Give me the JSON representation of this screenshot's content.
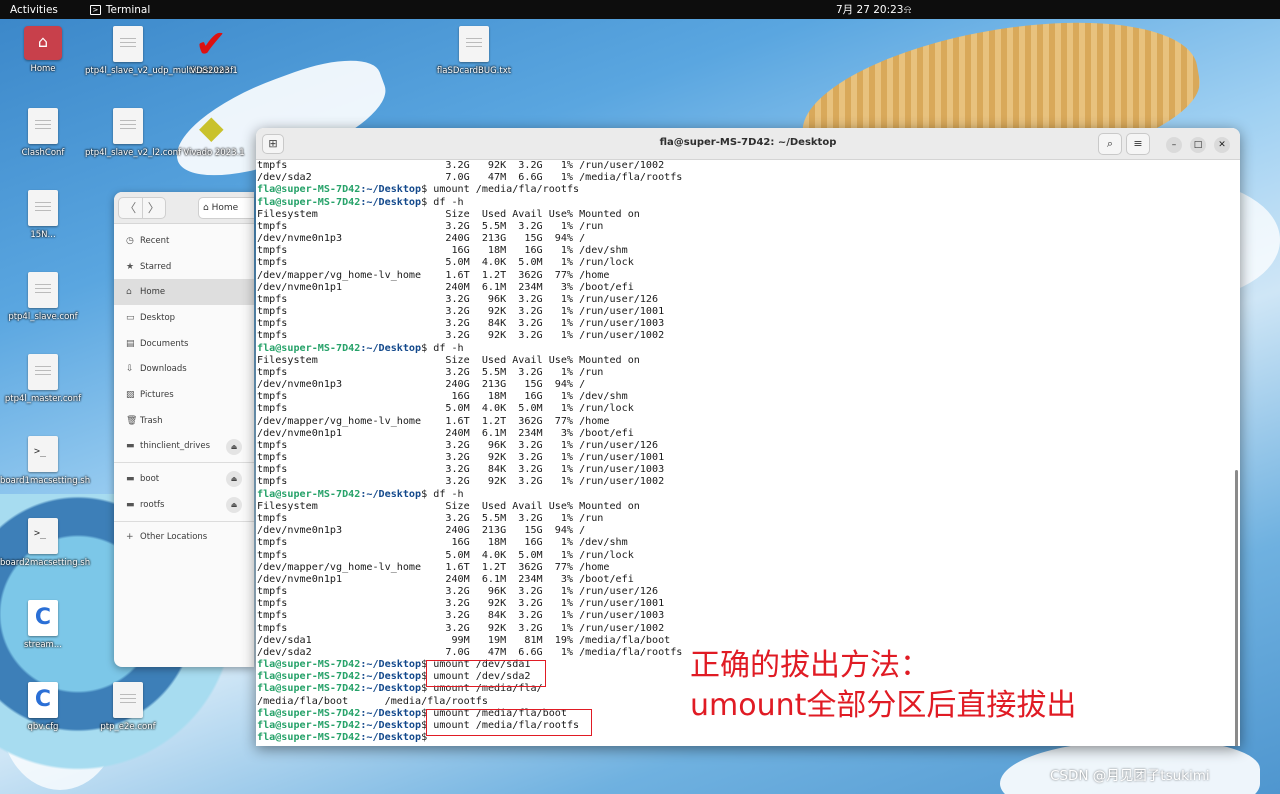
{
  "topbar": {
    "activities": "Activities",
    "app_name": "Terminal",
    "clock": "7月 27  20:23",
    "bell_icon": "bell-icon"
  },
  "desktop_icons": [
    {
      "label": "Home",
      "kind": "folder"
    },
    {
      "label": "ptp4l_slave_v2_udp_multicast.conf",
      "kind": "doc"
    },
    {
      "label": "VDS2023.1",
      "kind": "vds"
    },
    {
      "label": "flaSDcardBUG.txt",
      "kind": "doc"
    },
    {
      "label": "ClashConf",
      "kind": "doc"
    },
    {
      "label": "ptp4l_slave_v2_l2.conf",
      "kind": "doc"
    },
    {
      "label": "Vivado 2023.1",
      "kind": "vivado"
    },
    {
      "label": "15N...",
      "kind": "doc"
    },
    {
      "label": "ptp4l_slave.conf",
      "kind": "doc"
    },
    {
      "label": "ptp4l_master.conf",
      "kind": "doc"
    },
    {
      "label": "board1macsetting.sh",
      "kind": "script"
    },
    {
      "label": "board2macsetting.sh",
      "kind": "script"
    },
    {
      "label": "stream...",
      "kind": "c-icon"
    },
    {
      "label": "qbv.cfg",
      "kind": "c-icon"
    },
    {
      "label": "ptp_e2e.conf",
      "kind": "doc"
    }
  ],
  "files": {
    "back_glyph": "〈",
    "forward_glyph": "〉",
    "path_label": "Home",
    "sidebar": [
      {
        "label": "Recent",
        "icon": "◷"
      },
      {
        "label": "Starred",
        "icon": "★"
      },
      {
        "label": "Home",
        "icon": "⌂",
        "active": true
      },
      {
        "label": "Desktop",
        "icon": "▭"
      },
      {
        "label": "Documents",
        "icon": "▤"
      },
      {
        "label": "Downloads",
        "icon": "⇩"
      },
      {
        "label": "Pictures",
        "icon": "▨"
      },
      {
        "label": "Trash",
        "icon": "🗑"
      },
      {
        "label": "thinclient_drives",
        "icon": "▬",
        "eject": true
      }
    ],
    "devices": [
      {
        "label": "boot",
        "icon": "▬",
        "eject": true
      },
      {
        "label": "rootfs",
        "icon": "▬",
        "eject": true
      }
    ],
    "other_locations": "Other Locations",
    "other_icon": "+"
  },
  "terminal": {
    "title": "fla@super-MS-7D42: ~/Desktop",
    "prompt_user": "fla@super-MS-7D42",
    "prompt_dir": ":~/Desktop",
    "prompt_sym": "$ ",
    "lines": [
      {
        "t": "o",
        "text": "tmpfs                          3.2G   92K  3.2G   1% /run/user/1002"
      },
      {
        "t": "o",
        "text": "/dev/sda2                      7.0G   47M  6.6G   1% /media/fla/rootfs"
      },
      {
        "t": "p",
        "text": "umount /media/fla/rootfs"
      },
      {
        "t": "p",
        "text": "df -h"
      },
      {
        "t": "o",
        "text": "Filesystem                     Size  Used Avail Use% Mounted on"
      },
      {
        "t": "o",
        "text": "tmpfs                          3.2G  5.5M  3.2G   1% /run"
      },
      {
        "t": "o",
        "text": "/dev/nvme0n1p3                 240G  213G   15G  94% /"
      },
      {
        "t": "o",
        "text": "tmpfs                           16G   18M   16G   1% /dev/shm"
      },
      {
        "t": "o",
        "text": "tmpfs                          5.0M  4.0K  5.0M   1% /run/lock"
      },
      {
        "t": "o",
        "text": "/dev/mapper/vg_home-lv_home    1.6T  1.2T  362G  77% /home"
      },
      {
        "t": "o",
        "text": "/dev/nvme0n1p1                 240M  6.1M  234M   3% /boot/efi"
      },
      {
        "t": "o",
        "text": "tmpfs                          3.2G   96K  3.2G   1% /run/user/126"
      },
      {
        "t": "o",
        "text": "tmpfs                          3.2G   92K  3.2G   1% /run/user/1001"
      },
      {
        "t": "o",
        "text": "tmpfs                          3.2G   84K  3.2G   1% /run/user/1003"
      },
      {
        "t": "o",
        "text": "tmpfs                          3.2G   92K  3.2G   1% /run/user/1002"
      },
      {
        "t": "p",
        "text": "df -h"
      },
      {
        "t": "o",
        "text": "Filesystem                     Size  Used Avail Use% Mounted on"
      },
      {
        "t": "o",
        "text": "tmpfs                          3.2G  5.5M  3.2G   1% /run"
      },
      {
        "t": "o",
        "text": "/dev/nvme0n1p3                 240G  213G   15G  94% /"
      },
      {
        "t": "o",
        "text": "tmpfs                           16G   18M   16G   1% /dev/shm"
      },
      {
        "t": "o",
        "text": "tmpfs                          5.0M  4.0K  5.0M   1% /run/lock"
      },
      {
        "t": "o",
        "text": "/dev/mapper/vg_home-lv_home    1.6T  1.2T  362G  77% /home"
      },
      {
        "t": "o",
        "text": "/dev/nvme0n1p1                 240M  6.1M  234M   3% /boot/efi"
      },
      {
        "t": "o",
        "text": "tmpfs                          3.2G   96K  3.2G   1% /run/user/126"
      },
      {
        "t": "o",
        "text": "tmpfs                          3.2G   92K  3.2G   1% /run/user/1001"
      },
      {
        "t": "o",
        "text": "tmpfs                          3.2G   84K  3.2G   1% /run/user/1003"
      },
      {
        "t": "o",
        "text": "tmpfs                          3.2G   92K  3.2G   1% /run/user/1002"
      },
      {
        "t": "p",
        "text": "df -h"
      },
      {
        "t": "o",
        "text": "Filesystem                     Size  Used Avail Use% Mounted on"
      },
      {
        "t": "o",
        "text": "tmpfs                          3.2G  5.5M  3.2G   1% /run"
      },
      {
        "t": "o",
        "text": "/dev/nvme0n1p3                 240G  213G   15G  94% /"
      },
      {
        "t": "o",
        "text": "tmpfs                           16G   18M   16G   1% /dev/shm"
      },
      {
        "t": "o",
        "text": "tmpfs                          5.0M  4.0K  5.0M   1% /run/lock"
      },
      {
        "t": "o",
        "text": "/dev/mapper/vg_home-lv_home    1.6T  1.2T  362G  77% /home"
      },
      {
        "t": "o",
        "text": "/dev/nvme0n1p1                 240M  6.1M  234M   3% /boot/efi"
      },
      {
        "t": "o",
        "text": "tmpfs                          3.2G   96K  3.2G   1% /run/user/126"
      },
      {
        "t": "o",
        "text": "tmpfs                          3.2G   92K  3.2G   1% /run/user/1001"
      },
      {
        "t": "o",
        "text": "tmpfs                          3.2G   84K  3.2G   1% /run/user/1003"
      },
      {
        "t": "o",
        "text": "tmpfs                          3.2G   92K  3.2G   1% /run/user/1002"
      },
      {
        "t": "o",
        "text": "/dev/sda1                       99M   19M   81M  19% /media/fla/boot"
      },
      {
        "t": "o",
        "text": "/dev/sda2                      7.0G   47M  6.6G   1% /media/fla/rootfs"
      },
      {
        "t": "p",
        "text": "umount /dev/sda1"
      },
      {
        "t": "p",
        "text": "umount /dev/sda2"
      },
      {
        "t": "p",
        "text": "umount /media/fla/"
      },
      {
        "t": "o",
        "text": "/media/fla/boot      /media/fla/rootfs"
      },
      {
        "t": "p",
        "text": "umount /media/fla/boot"
      },
      {
        "t": "p",
        "text": "umount /media/fla/rootfs"
      },
      {
        "t": "p",
        "text": ""
      }
    ],
    "highlight_color": "#e01b24"
  },
  "annotation": {
    "line1": "正确的拔出方法：",
    "line2": "umount全部分区后直接拔出"
  },
  "watermark": "CSDN @月见团子tsukimi",
  "colors": {
    "prompt_user": "#26a269",
    "prompt_dir": "#12488b",
    "annotation": "#e01b24"
  }
}
